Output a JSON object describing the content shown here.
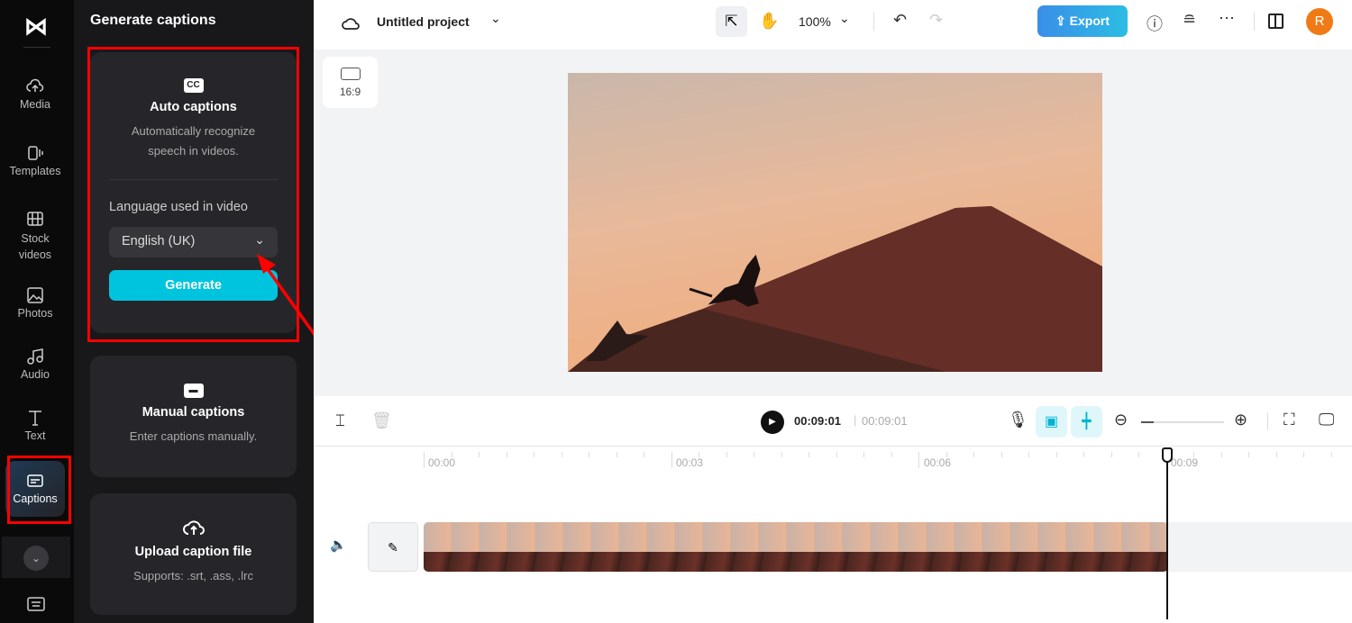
{
  "sidebar": {
    "items": [
      {
        "label": "Media",
        "icon": "cloud-upload-icon"
      },
      {
        "label": "Templates",
        "icon": "templates-icon"
      },
      {
        "label": "Stock videos",
        "icon": "film-icon"
      },
      {
        "label": "Photos",
        "icon": "image-icon"
      },
      {
        "label": "Audio",
        "icon": "music-icon"
      },
      {
        "label": "Text",
        "icon": "text-icon"
      },
      {
        "label": "Captions",
        "icon": "captions-icon",
        "active": true
      }
    ]
  },
  "panel": {
    "title": "Generate captions",
    "auto": {
      "icon_text": "CC",
      "title": "Auto captions",
      "desc1": "Automatically recognize",
      "desc2": "speech in videos.",
      "lang_label": "Language used in video",
      "lang_value": "English (UK)",
      "generate": "Generate"
    },
    "manual": {
      "title": "Manual captions",
      "desc": "Enter captions manually."
    },
    "upload": {
      "title": "Upload caption file",
      "desc": "Supports: .srt, .ass, .lrc"
    }
  },
  "header": {
    "project": "Untitled project",
    "zoom": "100%",
    "export": "Export",
    "avatar": "R"
  },
  "canvas": {
    "ratio": "16:9"
  },
  "player": {
    "current": "00:09:01",
    "total": "00:09:01"
  },
  "timeline": {
    "ticks": [
      "00:00",
      "00:03",
      "00:06",
      "00:09"
    ]
  },
  "colors": {
    "accent": "#00c4de",
    "export": "#3a9ae8",
    "avatar": "#f07b16",
    "highlight": "#ff0000"
  }
}
